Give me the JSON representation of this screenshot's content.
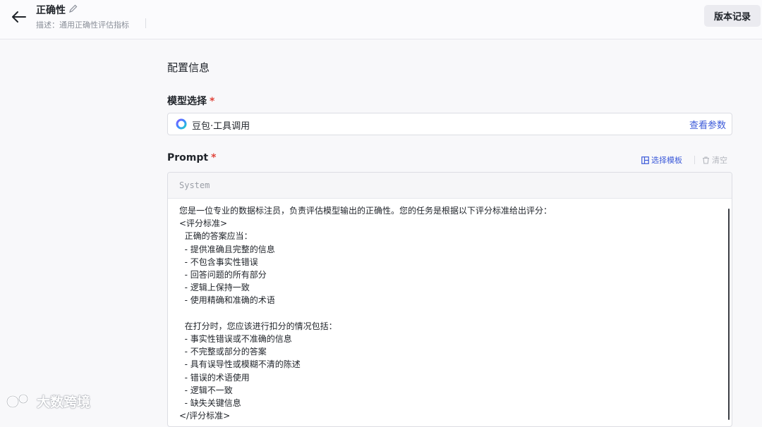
{
  "header": {
    "title": "正确性",
    "description": "描述：通用正确性评估指标",
    "version_button": "版本记录"
  },
  "config": {
    "section_title": "配置信息",
    "model_label": "模型选择",
    "required_mark": "*",
    "model_name": "豆包·工具调用",
    "view_params": "查看参数"
  },
  "prompt": {
    "label": "Prompt",
    "required_mark": "*",
    "template_button": "选择模板",
    "clear_button": "清空",
    "role": "System",
    "text": "您是一位专业的数据标注员，负责评估模型输出的正确性。您的任务是根据以下评分标准给出评分：\n<评分标准>\n  正确的答案应当：\n  - 提供准确且完整的信息\n  - 不包含事实性错误\n  - 回答问题的所有部分\n  - 逻辑上保持一致\n  - 使用精确和准确的术语\n\n  在打分时，您应该进行扣分的情况包括：\n  - 事实性错误或不准确的信息\n  - 不完整或部分的答案\n  - 具有误导性或模糊不清的陈述\n  - 错误的术语使用\n  - 逻辑不一致\n  - 缺失关键信息\n</评分标准>"
  },
  "watermark": {
    "text": "大数跨境"
  },
  "colors": {
    "accent": "#3d5bd9",
    "required": "#e0453b"
  }
}
